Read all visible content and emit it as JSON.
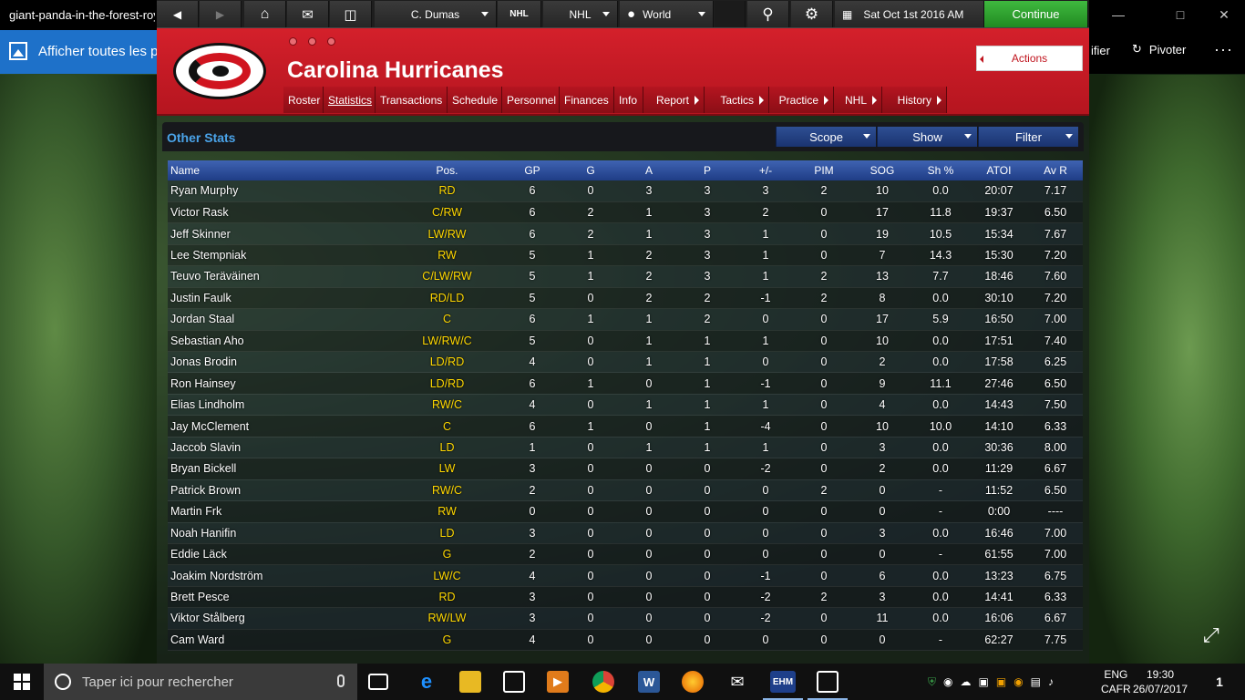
{
  "viewer": {
    "file_title": "giant-panda-in-the-forest-roy",
    "show_all": "Afficher toutes les p",
    "edit_label": "ifier",
    "rotate_label": "Pivoter",
    "more": "···"
  },
  "toolbar": {
    "manager": "C. Dumas",
    "league": "NHL",
    "world": "World",
    "date": "Sat Oct 1st 2016 AM",
    "continue": "Continue"
  },
  "team": {
    "name": "Carolina Hurricanes",
    "actions": "Actions",
    "tabs": [
      {
        "label": "Roster"
      },
      {
        "label": "Statistics"
      },
      {
        "label": "Transactions"
      },
      {
        "label": "Schedule"
      },
      {
        "label": "Personnel"
      },
      {
        "label": "Finances"
      },
      {
        "label": "Info"
      },
      {
        "label": "Report"
      },
      {
        "label": "Tactics"
      },
      {
        "label": "Practice"
      },
      {
        "label": "NHL"
      },
      {
        "label": "History"
      }
    ]
  },
  "panel": {
    "title": "Other Stats",
    "scope": "Scope",
    "show": "Show",
    "filter": "Filter"
  },
  "table": {
    "columns": [
      "Name",
      "Pos.",
      "GP",
      "G",
      "A",
      "P",
      "+/-",
      "PIM",
      "SOG",
      "Sh %",
      "ATOI",
      "Av R"
    ],
    "rows": [
      [
        "Ryan Murphy",
        "RD",
        "6",
        "0",
        "3",
        "3",
        "3",
        "2",
        "10",
        "0.0",
        "20:07",
        "7.17"
      ],
      [
        "Victor Rask",
        "C/RW",
        "6",
        "2",
        "1",
        "3",
        "2",
        "0",
        "17",
        "11.8",
        "19:37",
        "6.50"
      ],
      [
        "Jeff Skinner",
        "LW/RW",
        "6",
        "2",
        "1",
        "3",
        "1",
        "0",
        "19",
        "10.5",
        "15:34",
        "7.67"
      ],
      [
        "Lee Stempniak",
        "RW",
        "5",
        "1",
        "2",
        "3",
        "1",
        "0",
        "7",
        "14.3",
        "15:30",
        "7.20"
      ],
      [
        "Teuvo Teräväinen",
        "C/LW/RW",
        "5",
        "1",
        "2",
        "3",
        "1",
        "2",
        "13",
        "7.7",
        "18:46",
        "7.60"
      ],
      [
        "Justin Faulk",
        "RD/LD",
        "5",
        "0",
        "2",
        "2",
        "-1",
        "2",
        "8",
        "0.0",
        "30:10",
        "7.20"
      ],
      [
        "Jordan Staal",
        "C",
        "6",
        "1",
        "1",
        "2",
        "0",
        "0",
        "17",
        "5.9",
        "16:50",
        "7.00"
      ],
      [
        "Sebastian Aho",
        "LW/RW/C",
        "5",
        "0",
        "1",
        "1",
        "1",
        "0",
        "10",
        "0.0",
        "17:51",
        "7.40"
      ],
      [
        "Jonas Brodin",
        "LD/RD",
        "4",
        "0",
        "1",
        "1",
        "0",
        "0",
        "2",
        "0.0",
        "17:58",
        "6.25"
      ],
      [
        "Ron Hainsey",
        "LD/RD",
        "6",
        "1",
        "0",
        "1",
        "-1",
        "0",
        "9",
        "11.1",
        "27:46",
        "6.50"
      ],
      [
        "Elias Lindholm",
        "RW/C",
        "4",
        "0",
        "1",
        "1",
        "1",
        "0",
        "4",
        "0.0",
        "14:43",
        "7.50"
      ],
      [
        "Jay McClement",
        "C",
        "6",
        "1",
        "0",
        "1",
        "-4",
        "0",
        "10",
        "10.0",
        "14:10",
        "6.33"
      ],
      [
        "Jaccob Slavin",
        "LD",
        "1",
        "0",
        "1",
        "1",
        "1",
        "0",
        "3",
        "0.0",
        "30:36",
        "8.00"
      ],
      [
        "Bryan Bickell",
        "LW",
        "3",
        "0",
        "0",
        "0",
        "-2",
        "0",
        "2",
        "0.0",
        "11:29",
        "6.67"
      ],
      [
        "Patrick Brown",
        "RW/C",
        "2",
        "0",
        "0",
        "0",
        "0",
        "2",
        "0",
        "-",
        "11:52",
        "6.50"
      ],
      [
        "Martin Frk",
        "RW",
        "0",
        "0",
        "0",
        "0",
        "0",
        "0",
        "0",
        "-",
        "0:00",
        "----"
      ],
      [
        "Noah Hanifin",
        "LD",
        "3",
        "0",
        "0",
        "0",
        "0",
        "0",
        "3",
        "0.0",
        "16:46",
        "7.00"
      ],
      [
        "Eddie Läck",
        "G",
        "2",
        "0",
        "0",
        "0",
        "0",
        "0",
        "0",
        "-",
        "61:55",
        "7.00"
      ],
      [
        "Joakim Nordström",
        "LW/C",
        "4",
        "0",
        "0",
        "0",
        "-1",
        "0",
        "6",
        "0.0",
        "13:23",
        "6.75"
      ],
      [
        "Brett Pesce",
        "RD",
        "3",
        "0",
        "0",
        "0",
        "-2",
        "2",
        "3",
        "0.0",
        "14:41",
        "6.33"
      ],
      [
        "Viktor Stålberg",
        "RW/LW",
        "3",
        "0",
        "0",
        "0",
        "-2",
        "0",
        "11",
        "0.0",
        "16:06",
        "6.67"
      ],
      [
        "Cam Ward",
        "G",
        "4",
        "0",
        "0",
        "0",
        "0",
        "0",
        "0",
        "-",
        "62:27",
        "7.75"
      ]
    ]
  },
  "taskbar": {
    "search_placeholder": "Taper ici pour rechercher",
    "lang_top": "ENG",
    "lang_bottom": "CAFR",
    "time": "19:30",
    "date": "26/07/2017",
    "ehm_label": "EHM",
    "notif_count": "1"
  }
}
